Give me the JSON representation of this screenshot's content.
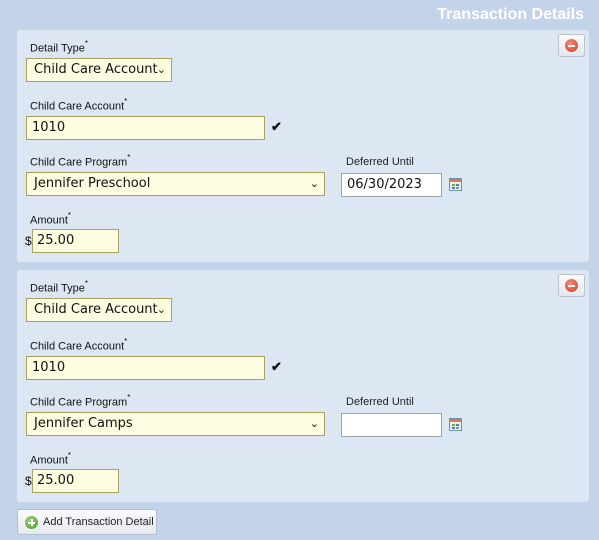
{
  "panel": {
    "title": "Transaction Details"
  },
  "required_marker": "*",
  "currency_symbol": "$",
  "labels": {
    "detail_type": "Detail Type",
    "child_care_account": "Child Care Account",
    "child_care_program": "Child Care Program",
    "deferred_until": "Deferred Until",
    "amount": "Amount"
  },
  "details": [
    {
      "detail_type": "Child Care Account",
      "account": "1010",
      "program": "Jennifer Preschool",
      "deferred_until": "06/30/2023",
      "amount": "25.00"
    },
    {
      "detail_type": "Child Care Account",
      "account": "1010",
      "program": "Jennifer Camps",
      "deferred_until": "",
      "amount": "25.00"
    }
  ],
  "add_button": {
    "label": "Add Transaction Detail"
  }
}
